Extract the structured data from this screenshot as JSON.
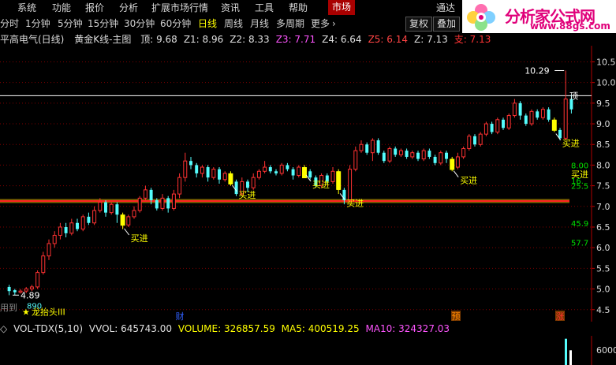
{
  "menu": {
    "items": [
      "系统",
      "功能",
      "报价",
      "分析",
      "扩展市场行情",
      "资讯",
      "工具",
      "帮助"
    ],
    "active": "市场",
    "right": [
      "通达"
    ]
  },
  "periods": {
    "items": [
      "分时",
      "1分钟",
      "5分钟",
      "15分钟",
      "30分钟",
      "60分钟",
      "日线",
      "周线",
      "月线",
      "多周期",
      "更多"
    ],
    "active": "日线",
    "more_icon": "chevron-right-icon",
    "buttons": [
      "复权",
      "叠加"
    ]
  },
  "logo": {
    "text": "分析家公式网",
    "url": "www.88gs.com"
  },
  "info": {
    "stock": "平高电气(日线)",
    "indicator": "黄金K线-主图",
    "values": [
      {
        "label": "顶: 9.68",
        "color": "#e0e0e0"
      },
      {
        "label": "Z1: 8.96",
        "color": "#e0e0e0"
      },
      {
        "label": "Z2: 8.33",
        "color": "#e0e0e0"
      },
      {
        "label": "Z3: 7.71",
        "color": "#ff55ff"
      },
      {
        "label": "Z4: 6.64",
        "color": "#e0e0e0"
      },
      {
        "label": "Z5: 6.14",
        "color": "#ff4444"
      },
      {
        "label": "Z: 7.13",
        "color": "#e0e0e0"
      },
      {
        "label": "支: 7.13",
        "color": "#ff3333"
      }
    ]
  },
  "price_axis": {
    "ticks": [
      "10.5",
      "10.0",
      "9.5",
      "9.0",
      "8.5",
      "8.0",
      "7.5",
      "7.0",
      "6.5",
      "6.0",
      "5.5",
      "5.0",
      "4.5"
    ],
    "right_values": [
      {
        "label": "8.00",
        "color": "#00e000",
        "y": 8.0
      },
      {
        "label": "16.",
        "color": "#00e000",
        "y": 7.63
      },
      {
        "label": "25.5",
        "color": "#00e000",
        "y": 7.5
      },
      {
        "label": "45.9",
        "color": "#00e000",
        "y": 6.6
      },
      {
        "label": "57.7",
        "color": "#00e000",
        "y": 6.13
      }
    ]
  },
  "annotations": {
    "high_label": "10.29",
    "low_label": "4.89",
    "top_label": "顶",
    "buy_label": "买进",
    "dragon_label": "龙抬头III",
    "dragon_value": "890",
    "left_note": "用到",
    "events": [
      "财",
      "预",
      "涨"
    ]
  },
  "volume": {
    "indicator": "VOL-TDX(5,10)",
    "vvol": "VVOL: 645743.00",
    "volume": "VOLUME: 326857.59",
    "ma5": "MA5: 400519.25",
    "ma10": "MA10: 324327.03",
    "axis_label": "6000"
  },
  "colors": {
    "up": "#ff3232",
    "down": "#54fcfc",
    "buy_bar": "#ffff00",
    "support": "#ff2020",
    "support_glow": "#ffcc00",
    "resistance": "#ffffff",
    "grid": "#800000"
  },
  "chart_data": {
    "type": "candlestick",
    "ylim": [
      4.4,
      10.7
    ],
    "support": 7.13,
    "resistance": 9.68,
    "candles": [
      {
        "o": 5.05,
        "c": 4.95,
        "h": 5.1,
        "l": 4.85
      },
      {
        "o": 4.97,
        "c": 4.92,
        "h": 5.0,
        "l": 4.85
      },
      {
        "o": 4.92,
        "c": 4.95,
        "h": 5.0,
        "l": 4.89
      },
      {
        "o": 4.95,
        "c": 5.0,
        "h": 5.05,
        "l": 4.9
      },
      {
        "o": 5.0,
        "c": 5.05,
        "h": 5.1,
        "l": 4.95
      },
      {
        "o": 5.05,
        "c": 5.4,
        "h": 5.45,
        "l": 5.0
      },
      {
        "o": 5.4,
        "c": 5.8,
        "h": 5.9,
        "l": 5.35
      },
      {
        "o": 5.8,
        "c": 6.1,
        "h": 6.2,
        "l": 5.7
      },
      {
        "o": 6.1,
        "c": 6.3,
        "h": 6.4,
        "l": 6.0
      },
      {
        "o": 6.3,
        "c": 6.5,
        "h": 6.6,
        "l": 6.2
      },
      {
        "o": 6.5,
        "c": 6.35,
        "h": 6.6,
        "l": 6.25
      },
      {
        "o": 6.35,
        "c": 6.6,
        "h": 6.7,
        "l": 6.3
      },
      {
        "o": 6.6,
        "c": 6.45,
        "h": 6.7,
        "l": 6.4
      },
      {
        "o": 6.45,
        "c": 6.75,
        "h": 6.8,
        "l": 6.4
      },
      {
        "o": 6.75,
        "c": 6.6,
        "h": 6.85,
        "l": 6.55
      },
      {
        "o": 6.6,
        "c": 6.9,
        "h": 7.0,
        "l": 6.55
      },
      {
        "o": 6.9,
        "c": 7.1,
        "h": 7.2,
        "l": 6.85
      },
      {
        "o": 7.1,
        "c": 6.85,
        "h": 7.15,
        "l": 6.75
      },
      {
        "o": 6.85,
        "c": 7.05,
        "h": 7.1,
        "l": 6.8
      },
      {
        "o": 7.05,
        "c": 6.8,
        "h": 7.1,
        "l": 6.6
      },
      {
        "o": 6.8,
        "c": 6.55,
        "h": 6.85,
        "l": 6.45
      },
      {
        "o": 6.55,
        "c": 6.75,
        "h": 6.8,
        "l": 6.5
      },
      {
        "o": 6.75,
        "c": 6.9,
        "h": 7.0,
        "l": 6.7
      },
      {
        "o": 6.9,
        "c": 7.2,
        "h": 7.25,
        "l": 6.85
      },
      {
        "o": 7.2,
        "c": 7.4,
        "h": 7.5,
        "l": 7.15
      },
      {
        "o": 7.4,
        "c": 7.15,
        "h": 7.45,
        "l": 7.05
      },
      {
        "o": 7.15,
        "c": 6.95,
        "h": 7.2,
        "l": 6.9
      },
      {
        "o": 6.95,
        "c": 7.2,
        "h": 7.3,
        "l": 6.9
      },
      {
        "o": 7.2,
        "c": 6.95,
        "h": 7.25,
        "l": 6.85
      },
      {
        "o": 6.95,
        "c": 7.3,
        "h": 7.4,
        "l": 6.9
      },
      {
        "o": 7.3,
        "c": 7.7,
        "h": 7.8,
        "l": 7.2
      },
      {
        "o": 7.7,
        "c": 8.1,
        "h": 8.3,
        "l": 7.6
      },
      {
        "o": 8.1,
        "c": 8.0,
        "h": 8.2,
        "l": 7.9
      },
      {
        "o": 8.0,
        "c": 7.8,
        "h": 8.05,
        "l": 7.7
      },
      {
        "o": 7.8,
        "c": 7.95,
        "h": 8.0,
        "l": 7.7
      },
      {
        "o": 7.95,
        "c": 7.7,
        "h": 8.0,
        "l": 7.6
      },
      {
        "o": 7.7,
        "c": 7.9,
        "h": 7.95,
        "l": 7.65
      },
      {
        "o": 7.9,
        "c": 7.65,
        "h": 7.95,
        "l": 7.55
      },
      {
        "o": 7.65,
        "c": 7.8,
        "h": 7.85,
        "l": 7.6
      },
      {
        "o": 7.8,
        "c": 7.6,
        "h": 7.85,
        "l": 7.5
      },
      {
        "o": 7.6,
        "c": 7.3,
        "h": 7.65,
        "l": 7.25
      },
      {
        "o": 7.3,
        "c": 7.6,
        "h": 7.7,
        "l": 7.25
      },
      {
        "o": 7.6,
        "c": 7.45,
        "h": 7.65,
        "l": 7.35
      },
      {
        "o": 7.45,
        "c": 7.7,
        "h": 7.8,
        "l": 7.4
      },
      {
        "o": 7.7,
        "c": 7.85,
        "h": 7.9,
        "l": 7.65
      },
      {
        "o": 7.85,
        "c": 7.95,
        "h": 8.1,
        "l": 7.8
      },
      {
        "o": 7.95,
        "c": 7.85,
        "h": 8.0,
        "l": 7.8
      },
      {
        "o": 7.85,
        "c": 7.8,
        "h": 7.9,
        "l": 7.75
      },
      {
        "o": 7.8,
        "c": 8.0,
        "h": 8.05,
        "l": 7.75
      },
      {
        "o": 8.0,
        "c": 7.9,
        "h": 8.05,
        "l": 7.85
      },
      {
        "o": 7.9,
        "c": 7.75,
        "h": 7.95,
        "l": 7.65
      },
      {
        "o": 7.75,
        "c": 7.95,
        "h": 8.0,
        "l": 7.7
      },
      {
        "o": 7.95,
        "c": 7.85,
        "h": 8.0,
        "l": 7.8
      },
      {
        "o": 7.85,
        "c": 7.7,
        "h": 7.9,
        "l": 7.65
      },
      {
        "o": 7.7,
        "c": 7.5,
        "h": 7.75,
        "l": 7.45
      },
      {
        "o": 7.5,
        "c": 7.75,
        "h": 7.8,
        "l": 7.45
      },
      {
        "o": 7.75,
        "c": 7.6,
        "h": 7.8,
        "l": 7.55
      },
      {
        "o": 7.6,
        "c": 7.85,
        "h": 7.95,
        "l": 7.55
      },
      {
        "o": 7.85,
        "c": 7.4,
        "h": 7.9,
        "l": 7.3
      },
      {
        "o": 7.4,
        "c": 7.15,
        "h": 7.45,
        "l": 7.05
      },
      {
        "o": 7.15,
        "c": 7.9,
        "h": 8.0,
        "l": 7.1
      },
      {
        "o": 7.9,
        "c": 8.35,
        "h": 8.45,
        "l": 7.85
      },
      {
        "o": 8.35,
        "c": 8.5,
        "h": 8.6,
        "l": 8.3
      },
      {
        "o": 8.5,
        "c": 8.3,
        "h": 8.55,
        "l": 8.25
      },
      {
        "o": 8.3,
        "c": 8.6,
        "h": 8.65,
        "l": 8.1
      },
      {
        "o": 8.6,
        "c": 8.3,
        "h": 8.65,
        "l": 8.25
      },
      {
        "o": 8.3,
        "c": 8.1,
        "h": 8.35,
        "l": 8.05
      },
      {
        "o": 8.1,
        "c": 8.4,
        "h": 8.45,
        "l": 8.05
      },
      {
        "o": 8.4,
        "c": 8.25,
        "h": 8.45,
        "l": 8.2
      },
      {
        "o": 8.25,
        "c": 8.35,
        "h": 8.4,
        "l": 8.2
      },
      {
        "o": 8.35,
        "c": 8.2,
        "h": 8.4,
        "l": 8.15
      },
      {
        "o": 8.2,
        "c": 8.3,
        "h": 8.35,
        "l": 8.15
      },
      {
        "o": 8.3,
        "c": 8.15,
        "h": 8.35,
        "l": 8.1
      },
      {
        "o": 8.15,
        "c": 8.35,
        "h": 8.4,
        "l": 8.1
      },
      {
        "o": 8.35,
        "c": 8.2,
        "h": 8.4,
        "l": 8.15
      },
      {
        "o": 8.2,
        "c": 8.05,
        "h": 8.25,
        "l": 8.0
      },
      {
        "o": 8.05,
        "c": 8.3,
        "h": 8.35,
        "l": 8.0
      },
      {
        "o": 8.3,
        "c": 8.15,
        "h": 8.35,
        "l": 8.05
      },
      {
        "o": 8.15,
        "c": 7.95,
        "h": 8.2,
        "l": 7.85
      },
      {
        "o": 7.95,
        "c": 8.2,
        "h": 8.3,
        "l": 7.9
      },
      {
        "o": 8.2,
        "c": 8.4,
        "h": 8.45,
        "l": 8.15
      },
      {
        "o": 8.4,
        "c": 8.7,
        "h": 8.75,
        "l": 8.35
      },
      {
        "o": 8.7,
        "c": 8.5,
        "h": 8.75,
        "l": 8.45
      },
      {
        "o": 8.5,
        "c": 8.75,
        "h": 8.8,
        "l": 8.45
      },
      {
        "o": 8.75,
        "c": 9.0,
        "h": 9.05,
        "l": 8.7
      },
      {
        "o": 9.0,
        "c": 8.8,
        "h": 9.05,
        "l": 8.75
      },
      {
        "o": 8.8,
        "c": 9.1,
        "h": 9.15,
        "l": 8.75
      },
      {
        "o": 9.1,
        "c": 8.9,
        "h": 9.15,
        "l": 8.85
      },
      {
        "o": 8.9,
        "c": 9.2,
        "h": 9.25,
        "l": 8.85
      },
      {
        "o": 9.2,
        "c": 9.5,
        "h": 9.6,
        "l": 9.15
      },
      {
        "o": 9.5,
        "c": 9.2,
        "h": 9.55,
        "l": 9.1
      },
      {
        "o": 9.2,
        "c": 9.0,
        "h": 9.25,
        "l": 8.95
      },
      {
        "o": 9.0,
        "c": 9.3,
        "h": 9.35,
        "l": 8.95
      },
      {
        "o": 9.3,
        "c": 9.15,
        "h": 9.35,
        "l": 9.1
      },
      {
        "o": 9.15,
        "c": 9.35,
        "h": 9.4,
        "l": 9.1
      },
      {
        "o": 9.35,
        "c": 9.1,
        "h": 9.4,
        "l": 9.05
      },
      {
        "o": 9.1,
        "c": 8.85,
        "h": 9.15,
        "l": 8.8
      },
      {
        "o": 8.85,
        "c": 8.65,
        "h": 8.9,
        "l": 8.6
      },
      {
        "o": 8.65,
        "c": 9.6,
        "h": 10.29,
        "l": 8.6
      },
      {
        "o": 9.6,
        "c": 9.35,
        "h": 9.7,
        "l": 9.25
      }
    ],
    "buy_signals": [
      {
        "index": 20,
        "label": "买进"
      },
      {
        "index": 39,
        "label": "买进"
      },
      {
        "index": 52,
        "label": "买进"
      },
      {
        "index": 58,
        "label": "买进"
      },
      {
        "index": 78,
        "label": "买进"
      },
      {
        "index": 96,
        "label": "买进"
      }
    ],
    "volumes": [
      0.98,
      0.55
    ]
  }
}
